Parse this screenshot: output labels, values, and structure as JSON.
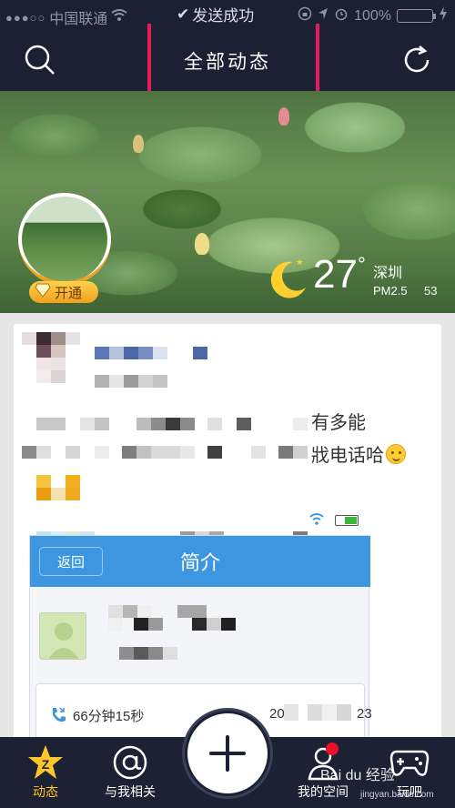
{
  "status_bar": {
    "carrier": "中国联通",
    "battery": "100%",
    "toast": "发送成功",
    "colors": {
      "battery": "#4cd964",
      "highlight": "#e8195c"
    }
  },
  "nav": {
    "title": "全部动态",
    "left_icon": "search-icon",
    "right_icon": "refresh-icon"
  },
  "cover": {
    "vip_label": "开通",
    "weather": {
      "temperature": "27",
      "degree": "°",
      "city": "深圳",
      "pm_label": "PM2.5",
      "pm_value": "53",
      "icon": "moon-star-icon"
    }
  },
  "post": {
    "text_line_1": "有多能",
    "text_line_2": "戕电话哈",
    "emoji": "smiley-icon",
    "screenshot": {
      "back_label": "返回",
      "title": "简介",
      "call_duration": "66分钟15秒",
      "call_date_start": "20",
      "call_date_end": "23"
    }
  },
  "tabbar": {
    "tabs": [
      {
        "label": "动态",
        "icon": "qzone-star-icon",
        "active": true
      },
      {
        "label": "与我相关",
        "icon": "at-icon",
        "active": false
      },
      {
        "label": "我的空间",
        "icon": "user-icon",
        "active": false
      },
      {
        "label": "玩吧",
        "icon": "gamepad-icon",
        "active": false
      }
    ],
    "center_icon": "plus-icon",
    "accent_color": "#ffc62b"
  },
  "watermark": {
    "brand": "Bai du 经验",
    "url": "jingyan.baidu.com"
  }
}
